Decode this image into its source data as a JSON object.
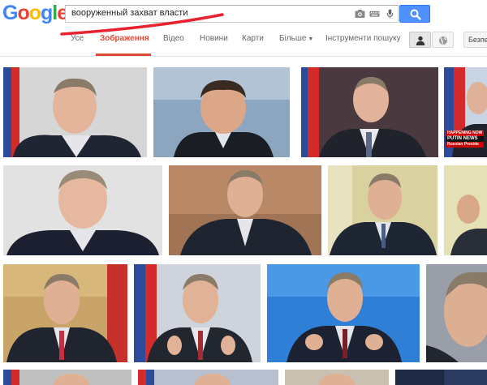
{
  "logo": {
    "letters": [
      "G",
      "o",
      "o",
      "g",
      "l",
      "e"
    ]
  },
  "search": {
    "query": "вооруженный захват власти"
  },
  "tabs": [
    {
      "label": "Усе"
    },
    {
      "label": "Зображення"
    },
    {
      "label": "Відео"
    },
    {
      "label": "Новини"
    },
    {
      "label": "Карти"
    },
    {
      "label": "Більше"
    },
    {
      "label": "Інструменти пошуку"
    }
  ],
  "active_tab": "Зображення",
  "safe_search": {
    "label": "Безпе"
  },
  "news_badge": {
    "line1": "HAPPENING NOW",
    "line2": "PUTIN NEWS",
    "line3": "Russian Preside"
  },
  "colors": {
    "accent": "#dd4b39",
    "search_button": "#4d90fe",
    "annotation": "#e8222e"
  }
}
